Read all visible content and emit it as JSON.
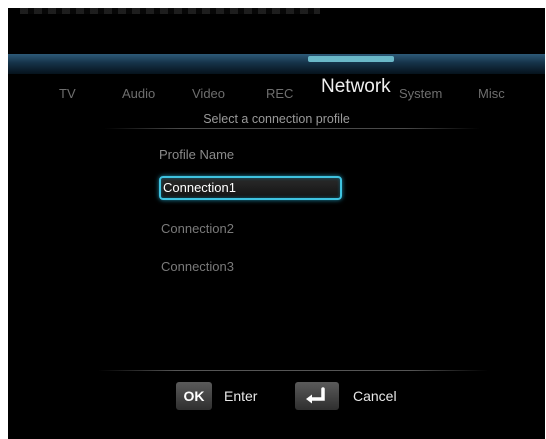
{
  "tabs": [
    {
      "label": "TV"
    },
    {
      "label": "Audio"
    },
    {
      "label": "Video"
    },
    {
      "label": "REC"
    },
    {
      "label": "Network"
    },
    {
      "label": "System"
    },
    {
      "label": "Misc"
    }
  ],
  "active_tab": "Network",
  "subtitle": "Select a connection profile",
  "profile_label": "Profile Name",
  "profiles": [
    {
      "label": "Connection1",
      "selected": true
    },
    {
      "label": "Connection2",
      "selected": false
    },
    {
      "label": "Connection3",
      "selected": false
    }
  ],
  "footer": {
    "ok_key": "OK",
    "ok_label": "Enter",
    "back_key_icon": "return-arrow-icon",
    "back_label": "Cancel"
  },
  "colors": {
    "selection_border": "#3fc3e0",
    "header_bar": "#153248"
  }
}
